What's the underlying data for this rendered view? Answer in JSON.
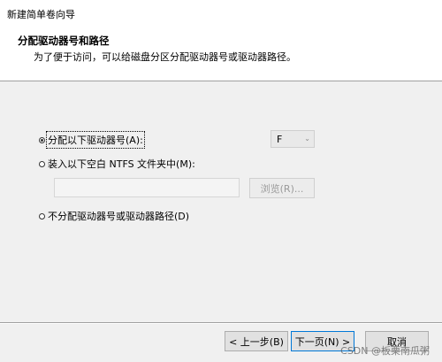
{
  "window": {
    "title": "新建简单卷向导"
  },
  "header": {
    "title": "分配驱动器号和路径",
    "subtitle": "为了便于访问，可以给磁盘分区分配驱动器号或驱动器路径。"
  },
  "options": {
    "assign_letter": {
      "label": "分配以下驱动器号(A):",
      "selected": true
    },
    "mount_folder": {
      "label": "装入以下空白 NTFS 文件夹中(M):",
      "selected": false
    },
    "no_assign": {
      "label": "不分配驱动器号或驱动器路径(D)",
      "selected": false
    }
  },
  "drive_letter": {
    "value": "F"
  },
  "folder_path": {
    "value": "",
    "browse_label": "浏览(R)..."
  },
  "footer": {
    "back_label": "< 上一步(B)",
    "next_label": "下一页(N) >",
    "cancel_label": "取消"
  },
  "watermark": {
    "text": "CSDN @板栗南瓜粥"
  },
  "colors": {
    "focus_border": "#0078d7",
    "header_bg": "#ffffff",
    "body_bg": "#f0f0f0"
  },
  "icons": {
    "dropdown": "chevron-down-icon"
  }
}
